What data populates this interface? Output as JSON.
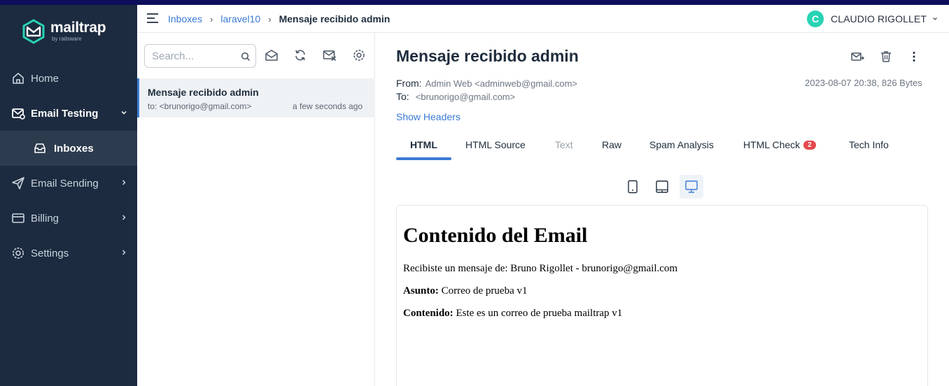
{
  "brand": {
    "name": "mailtrap",
    "tagline": "by railsware",
    "logo_icon": "mailtrap-logo-icon",
    "accent": "#29d3b4"
  },
  "sidebar": {
    "items": [
      {
        "label": "Home",
        "icon": "home-icon"
      },
      {
        "label": "Email Testing",
        "icon": "email-testing-icon"
      },
      {
        "label": "Inboxes",
        "icon": "inbox-icon"
      },
      {
        "label": "Email Sending",
        "icon": "send-icon"
      },
      {
        "label": "Billing",
        "icon": "credit-card-icon"
      },
      {
        "label": "Settings",
        "icon": "gear-icon"
      }
    ]
  },
  "header": {
    "breadcrumb": [
      "Inboxes",
      "laravel10",
      "Mensaje recibido admin"
    ],
    "user": {
      "initial": "C",
      "name": "CLAUDIO RIGOLLET"
    }
  },
  "inbox": {
    "search_placeholder": "Search...",
    "messages": [
      {
        "subject": "Mensaje recibido admin",
        "to": "to: <brunorigo@gmail.com>",
        "time": "a few seconds ago"
      }
    ]
  },
  "message": {
    "title": "Mensaje recibido admin",
    "from_label": "From:",
    "from": "Admin Web <adminweb@gmail.com>",
    "to_label": "To:",
    "to": "<brunorigo@gmail.com>",
    "meta": "2023-08-07 20:38, 826 Bytes",
    "show_headers": "Show Headers",
    "tabs": [
      {
        "label": "HTML",
        "state": "active"
      },
      {
        "label": "HTML Source",
        "state": "normal"
      },
      {
        "label": "Text",
        "state": "disabled"
      },
      {
        "label": "Raw",
        "state": "normal"
      },
      {
        "label": "Spam Analysis",
        "state": "normal"
      },
      {
        "label": "HTML Check",
        "state": "normal",
        "badge": "2"
      },
      {
        "label": "Tech Info",
        "state": "normal"
      }
    ],
    "device_views": [
      "mobile-icon",
      "tablet-icon",
      "desktop-icon"
    ],
    "active_device": "desktop-icon"
  },
  "email": {
    "heading": "Contenido del Email",
    "line1": "Recibiste un mensaje de: Bruno Rigollet - brunorigo@gmail.com",
    "subject_label": "Asunto:",
    "subject_value": "Correo de prueba v1",
    "content_label": "Contenido:",
    "content_value": "Este es un correo de prueba mailtrap v1"
  }
}
